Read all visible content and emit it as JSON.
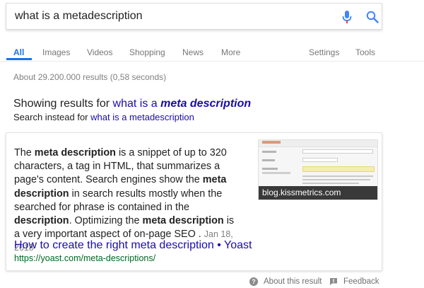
{
  "search": {
    "value": "what is a metadescription",
    "mic_icon": "microphone-icon",
    "search_icon": "magnifier-icon",
    "accent_blue": "#4285f4",
    "accent_red": "#ea4335"
  },
  "tabs": {
    "items": [
      "All",
      "Images",
      "Videos",
      "Shopping",
      "News",
      "More"
    ],
    "settings": "Settings",
    "tools": "Tools",
    "active": "All",
    "active_color": "#1a73e8"
  },
  "stats": "About 29.200.000 results (0,58 seconds)",
  "correction": {
    "showing_prefix": "Showing results for ",
    "corrected_plain": "what is a ",
    "corrected_bold": "meta description",
    "instead_prefix": "Search instead for ",
    "instead_query": "what is a metadescription"
  },
  "featured_snippet": {
    "parts": [
      {
        "text": "The ",
        "bold": false
      },
      {
        "text": "meta description",
        "bold": true
      },
      {
        "text": " is a snippet of up to 320 characters, a tag in HTML, that summarizes a page's content. Search engines show the ",
        "bold": false
      },
      {
        "text": "meta description",
        "bold": true
      },
      {
        "text": " in search results mostly when the searched for phrase is contained in the ",
        "bold": false
      },
      {
        "text": "description",
        "bold": true
      },
      {
        "text": ". Optimizing the ",
        "bold": false
      },
      {
        "text": "meta description",
        "bold": true
      },
      {
        "text": " is a very important aspect of on-page SEO . ",
        "bold": false
      }
    ],
    "date": "Jan 18, 2018",
    "image_caption": "blog.kissmetrics.com",
    "result_title": "How to create the right meta description • Yoast",
    "result_url": "https://yoast.com/meta-descriptions/",
    "link_color": "#1a0dab",
    "url_color": "#006621"
  },
  "footer": {
    "about": "About this result",
    "about_icon": "help-circle-icon",
    "feedback": "Feedback",
    "feedback_icon": "feedback-icon"
  }
}
